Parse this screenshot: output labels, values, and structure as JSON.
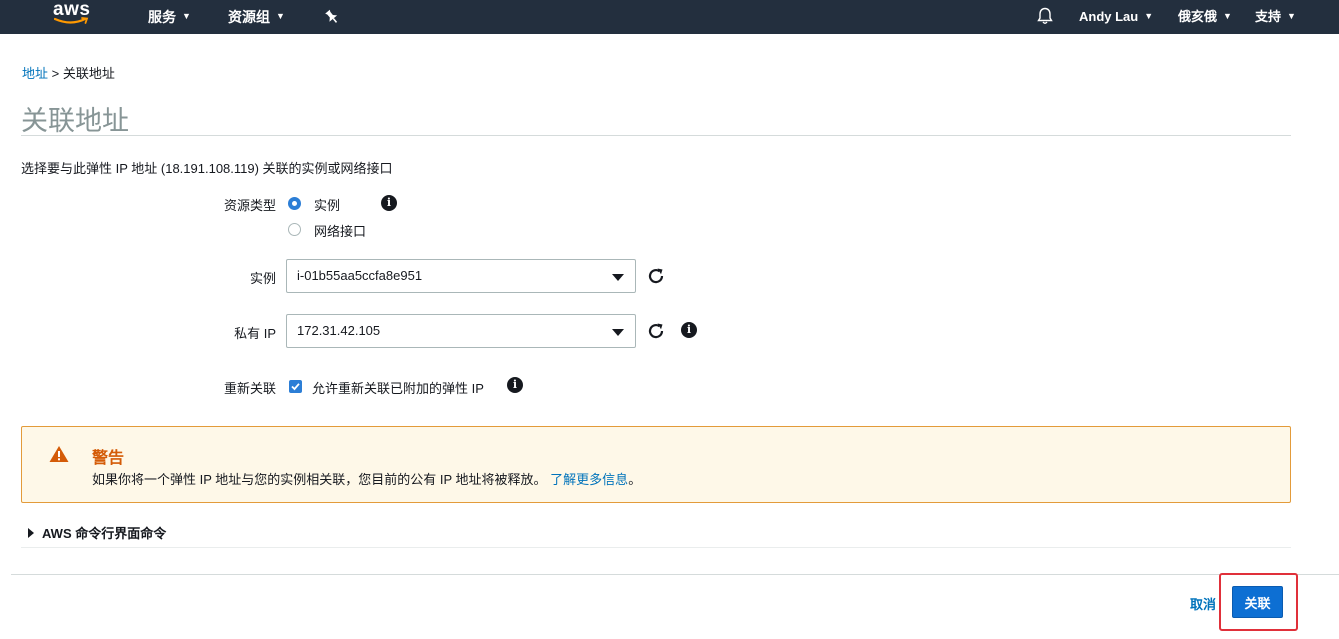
{
  "topbar": {
    "logo_text": "aws",
    "services_label": "服务",
    "resource_groups_label": "资源组",
    "user_label": "Andy Lau",
    "region_label": "俄亥俄",
    "support_label": "支持",
    "caret": "▼",
    "icons": [
      "pin-icon",
      "bell-icon"
    ]
  },
  "breadcrumb": {
    "parent": "地址",
    "separator": ">",
    "current": "关联地址"
  },
  "page": {
    "title": "关联地址",
    "description": "选择要与此弹性 IP 地址 (18.191.108.119) 关联的实例或网络接口"
  },
  "form": {
    "resource_type_label": "资源类型",
    "resource_type_options": [
      "实例",
      "网络接口"
    ],
    "resource_type_selected": "实例",
    "instance_label": "实例",
    "instance_value": "i-01b55aa5ccfa8e951",
    "private_ip_label": "私有 IP",
    "private_ip_value": "172.31.42.105",
    "reassociate_label": "重新关联",
    "reassociate_text": "允许重新关联已附加的弹性 IP",
    "reassociate_checked": true,
    "info_glyph": "i"
  },
  "warning": {
    "title": "警告",
    "text": "如果你将一个弹性 IP 地址与您的实例相关联，您目前的公有 IP 地址将被释放。",
    "link_text": "了解更多信息",
    "suffix": "。"
  },
  "cli": {
    "label": "AWS 命令行界面命令"
  },
  "actions": {
    "cancel_label": "取消",
    "associate_label": "关联"
  },
  "colors": {
    "topbar_bg": "#232f3e",
    "link": "#0073bb",
    "primary": "#0d6fd3",
    "warning_title": "#d45b07",
    "warning_border": "#e39b3a",
    "highlight": "#e0303a"
  }
}
